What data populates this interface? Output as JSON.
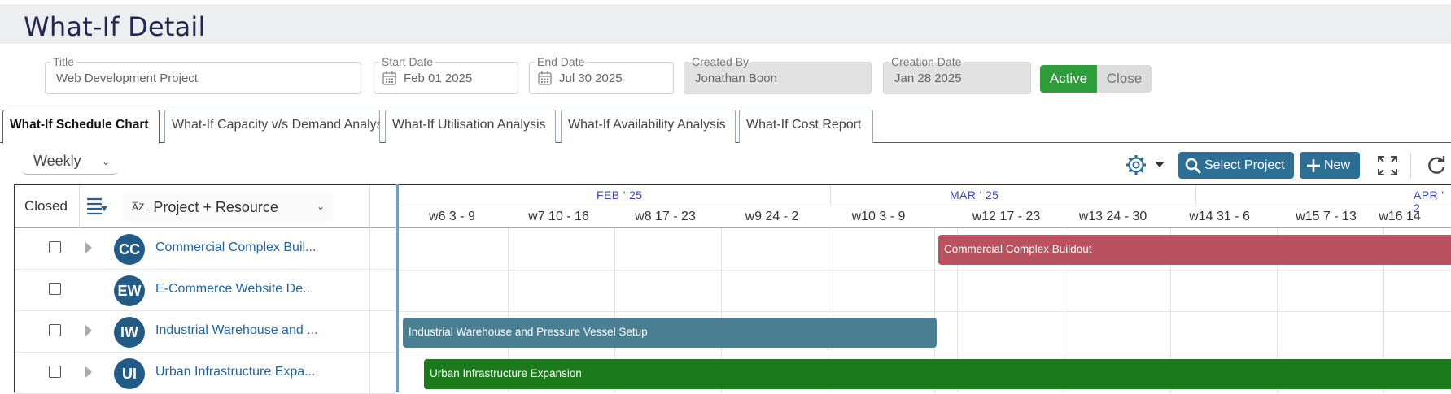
{
  "page": {
    "title": "What-If Detail"
  },
  "form": {
    "title_label": "Title",
    "title_value": "Web Development Project",
    "start_label": "Start Date",
    "start_value": "Feb 01 2025",
    "end_label": "End Date",
    "end_value": "Jul 30 2025",
    "created_by_label": "Created By",
    "created_by_value": "Jonathan Boon",
    "creation_date_label": "Creation Date",
    "creation_date_value": "Jan 28 2025",
    "status_active": "Active",
    "status_close": "Close"
  },
  "tabs": [
    {
      "label": "What-If Schedule Chart",
      "selected": true
    },
    {
      "label": "What-If Capacity v/s Demand Analysis",
      "selected": false
    },
    {
      "label": "What-If Utilisation Analysis",
      "selected": false
    },
    {
      "label": "What-If Availability Analysis",
      "selected": false
    },
    {
      "label": "What-If Cost Report",
      "selected": false
    }
  ],
  "toolbar": {
    "view": "Weekly",
    "select_project": "Select Project",
    "new": "New"
  },
  "grid": {
    "closed_header": "Closed",
    "group_by": "Project + Resource",
    "rows": [
      {
        "initials": "CC",
        "name": "Commercial Complex Buil...",
        "expandable": true
      },
      {
        "initials": "EW",
        "name": "E-Commerce Website De...",
        "expandable": false
      },
      {
        "initials": "IW",
        "name": "Industrial Warehouse and ...",
        "expandable": true
      },
      {
        "initials": "UI",
        "name": "Urban Infrastructure Expa...",
        "expandable": true
      }
    ]
  },
  "timeline": {
    "months": [
      "FEB ' 25",
      "MAR ' 25",
      "APR ' 2"
    ],
    "weeks": [
      "w6 3 - 9",
      "w7 10 - 16",
      "w8 17 - 23",
      "w9 24 - 2",
      "w10 3 - 9",
      "w12 17 - 23",
      "w13 24 - 30",
      "w14 31 - 6",
      "w15 7 - 13",
      "w16 14"
    ],
    "bars": [
      {
        "label": "Commercial Complex Buildout",
        "color": "#b9515e"
      },
      {
        "label": "Industrial Warehouse and Pressure Vessel Setup",
        "color": "#4a7f93"
      },
      {
        "label": "Urban Infrastructure Expansion",
        "color": "#1a7a1a"
      }
    ]
  },
  "colors": {
    "accent": "#2c6f95",
    "active": "#2e9e3b",
    "avatar": "#225c86",
    "link": "#1f64a7"
  }
}
